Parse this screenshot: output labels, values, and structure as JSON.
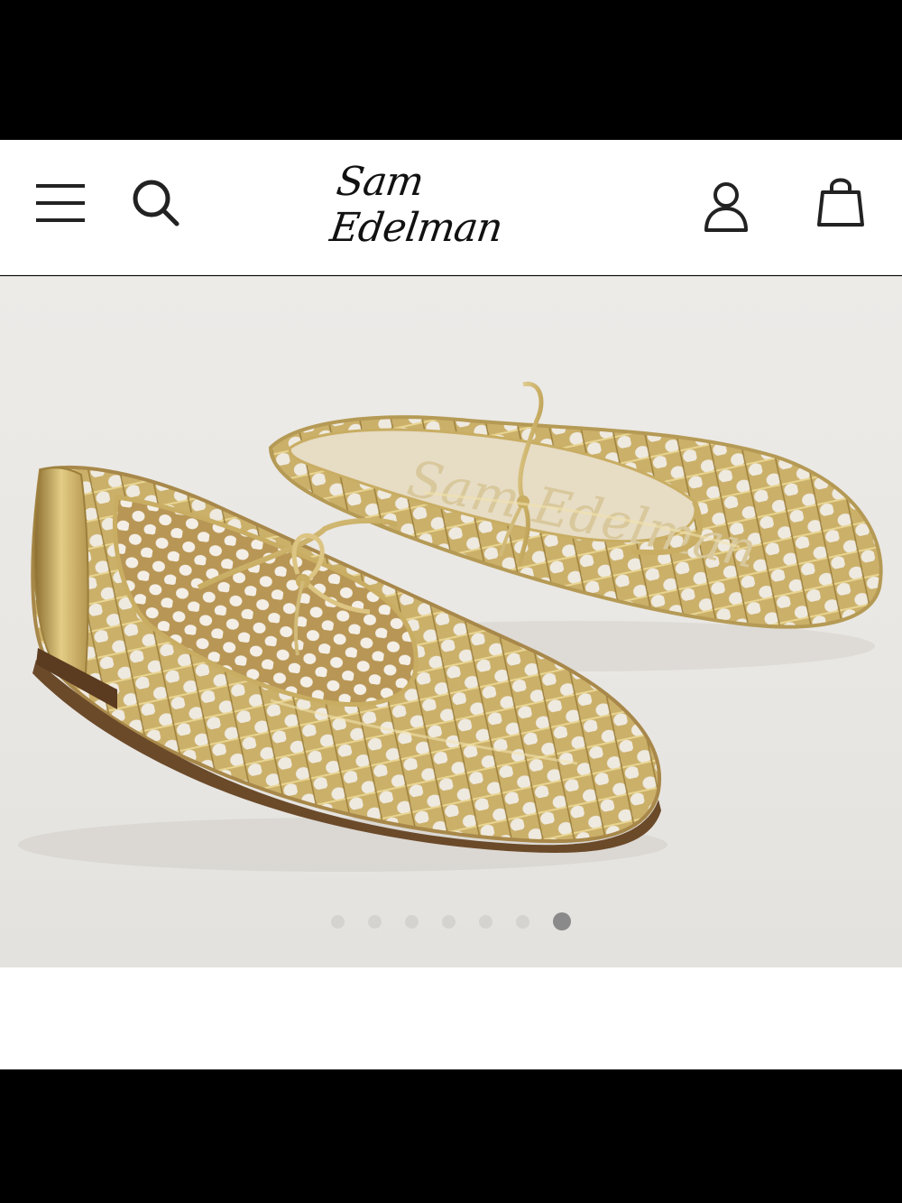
{
  "header": {
    "brand": "Sam Edelman",
    "icons": [
      "hamburger-menu-icon",
      "search-icon",
      "account-icon",
      "shopping-bag-icon"
    ]
  },
  "gallery": {
    "image": "gold-woven-ballet-flats",
    "insole_logo": "Sam Edelman",
    "slide_count": 7,
    "active_slide": 7
  },
  "colors": {
    "dot_inactive": "#d4d3d0",
    "dot_active": "#8a8a8a",
    "gold": "#c9b06a"
  }
}
